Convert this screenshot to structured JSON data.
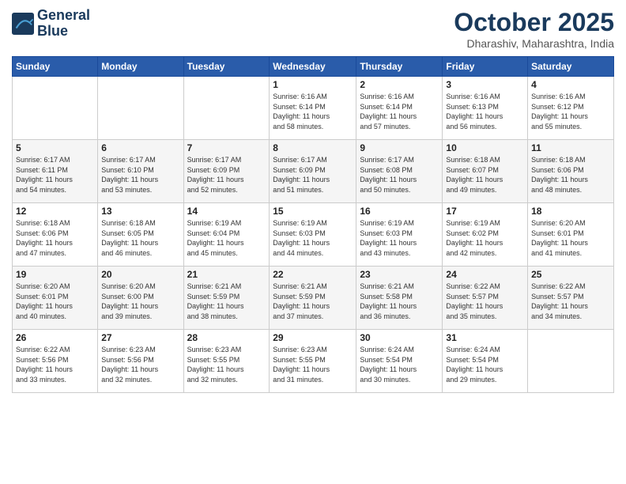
{
  "header": {
    "logo_line1": "General",
    "logo_line2": "Blue",
    "month_title": "October 2025",
    "location": "Dharashiv, Maharashtra, India"
  },
  "weekdays": [
    "Sunday",
    "Monday",
    "Tuesday",
    "Wednesday",
    "Thursday",
    "Friday",
    "Saturday"
  ],
  "weeks": [
    [
      {
        "day": "",
        "info": ""
      },
      {
        "day": "",
        "info": ""
      },
      {
        "day": "",
        "info": ""
      },
      {
        "day": "1",
        "info": "Sunrise: 6:16 AM\nSunset: 6:14 PM\nDaylight: 11 hours\nand 58 minutes."
      },
      {
        "day": "2",
        "info": "Sunrise: 6:16 AM\nSunset: 6:14 PM\nDaylight: 11 hours\nand 57 minutes."
      },
      {
        "day": "3",
        "info": "Sunrise: 6:16 AM\nSunset: 6:13 PM\nDaylight: 11 hours\nand 56 minutes."
      },
      {
        "day": "4",
        "info": "Sunrise: 6:16 AM\nSunset: 6:12 PM\nDaylight: 11 hours\nand 55 minutes."
      }
    ],
    [
      {
        "day": "5",
        "info": "Sunrise: 6:17 AM\nSunset: 6:11 PM\nDaylight: 11 hours\nand 54 minutes."
      },
      {
        "day": "6",
        "info": "Sunrise: 6:17 AM\nSunset: 6:10 PM\nDaylight: 11 hours\nand 53 minutes."
      },
      {
        "day": "7",
        "info": "Sunrise: 6:17 AM\nSunset: 6:09 PM\nDaylight: 11 hours\nand 52 minutes."
      },
      {
        "day": "8",
        "info": "Sunrise: 6:17 AM\nSunset: 6:09 PM\nDaylight: 11 hours\nand 51 minutes."
      },
      {
        "day": "9",
        "info": "Sunrise: 6:17 AM\nSunset: 6:08 PM\nDaylight: 11 hours\nand 50 minutes."
      },
      {
        "day": "10",
        "info": "Sunrise: 6:18 AM\nSunset: 6:07 PM\nDaylight: 11 hours\nand 49 minutes."
      },
      {
        "day": "11",
        "info": "Sunrise: 6:18 AM\nSunset: 6:06 PM\nDaylight: 11 hours\nand 48 minutes."
      }
    ],
    [
      {
        "day": "12",
        "info": "Sunrise: 6:18 AM\nSunset: 6:06 PM\nDaylight: 11 hours\nand 47 minutes."
      },
      {
        "day": "13",
        "info": "Sunrise: 6:18 AM\nSunset: 6:05 PM\nDaylight: 11 hours\nand 46 minutes."
      },
      {
        "day": "14",
        "info": "Sunrise: 6:19 AM\nSunset: 6:04 PM\nDaylight: 11 hours\nand 45 minutes."
      },
      {
        "day": "15",
        "info": "Sunrise: 6:19 AM\nSunset: 6:03 PM\nDaylight: 11 hours\nand 44 minutes."
      },
      {
        "day": "16",
        "info": "Sunrise: 6:19 AM\nSunset: 6:03 PM\nDaylight: 11 hours\nand 43 minutes."
      },
      {
        "day": "17",
        "info": "Sunrise: 6:19 AM\nSunset: 6:02 PM\nDaylight: 11 hours\nand 42 minutes."
      },
      {
        "day": "18",
        "info": "Sunrise: 6:20 AM\nSunset: 6:01 PM\nDaylight: 11 hours\nand 41 minutes."
      }
    ],
    [
      {
        "day": "19",
        "info": "Sunrise: 6:20 AM\nSunset: 6:01 PM\nDaylight: 11 hours\nand 40 minutes."
      },
      {
        "day": "20",
        "info": "Sunrise: 6:20 AM\nSunset: 6:00 PM\nDaylight: 11 hours\nand 39 minutes."
      },
      {
        "day": "21",
        "info": "Sunrise: 6:21 AM\nSunset: 5:59 PM\nDaylight: 11 hours\nand 38 minutes."
      },
      {
        "day": "22",
        "info": "Sunrise: 6:21 AM\nSunset: 5:59 PM\nDaylight: 11 hours\nand 37 minutes."
      },
      {
        "day": "23",
        "info": "Sunrise: 6:21 AM\nSunset: 5:58 PM\nDaylight: 11 hours\nand 36 minutes."
      },
      {
        "day": "24",
        "info": "Sunrise: 6:22 AM\nSunset: 5:57 PM\nDaylight: 11 hours\nand 35 minutes."
      },
      {
        "day": "25",
        "info": "Sunrise: 6:22 AM\nSunset: 5:57 PM\nDaylight: 11 hours\nand 34 minutes."
      }
    ],
    [
      {
        "day": "26",
        "info": "Sunrise: 6:22 AM\nSunset: 5:56 PM\nDaylight: 11 hours\nand 33 minutes."
      },
      {
        "day": "27",
        "info": "Sunrise: 6:23 AM\nSunset: 5:56 PM\nDaylight: 11 hours\nand 32 minutes."
      },
      {
        "day": "28",
        "info": "Sunrise: 6:23 AM\nSunset: 5:55 PM\nDaylight: 11 hours\nand 32 minutes."
      },
      {
        "day": "29",
        "info": "Sunrise: 6:23 AM\nSunset: 5:55 PM\nDaylight: 11 hours\nand 31 minutes."
      },
      {
        "day": "30",
        "info": "Sunrise: 6:24 AM\nSunset: 5:54 PM\nDaylight: 11 hours\nand 30 minutes."
      },
      {
        "day": "31",
        "info": "Sunrise: 6:24 AM\nSunset: 5:54 PM\nDaylight: 11 hours\nand 29 minutes."
      },
      {
        "day": "",
        "info": ""
      }
    ]
  ]
}
